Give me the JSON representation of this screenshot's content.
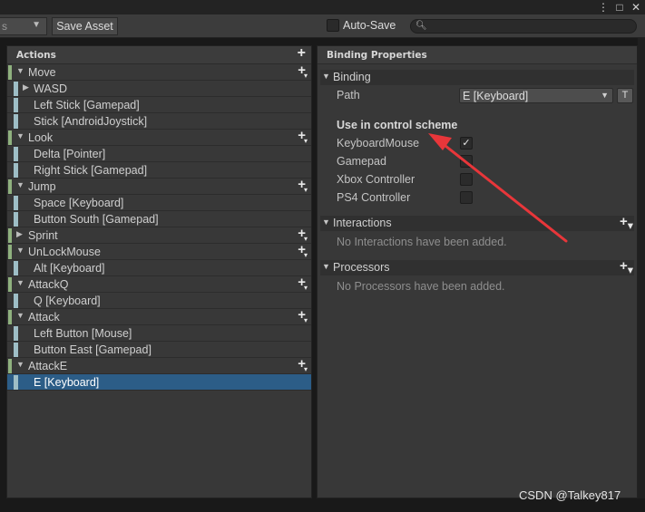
{
  "window": {
    "more_icon": "kebab-menu-icon",
    "maximize_icon": "maximize-icon",
    "close_icon": "close-icon"
  },
  "toolbar": {
    "control_scheme_partial": "s",
    "save_asset_label": "Save Asset",
    "auto_save_label": "Auto-Save",
    "auto_save_checked": false,
    "search_value": ""
  },
  "actions_pane": {
    "header": "Actions",
    "rows": [
      {
        "kind": "action",
        "label": "Move"
      },
      {
        "kind": "composite",
        "label": "WASD"
      },
      {
        "kind": "binding",
        "label": "Left Stick [Gamepad]"
      },
      {
        "kind": "binding",
        "label": "Stick [AndroidJoystick]"
      },
      {
        "kind": "action",
        "label": "Look"
      },
      {
        "kind": "binding",
        "label": "Delta [Pointer]"
      },
      {
        "kind": "binding",
        "label": "Right Stick [Gamepad]"
      },
      {
        "kind": "action",
        "label": "Jump"
      },
      {
        "kind": "binding",
        "label": "Space [Keyboard]"
      },
      {
        "kind": "binding",
        "label": "Button South [Gamepad]"
      },
      {
        "kind": "action-collapsed",
        "label": "Sprint"
      },
      {
        "kind": "action",
        "label": "UnLockMouse"
      },
      {
        "kind": "binding",
        "label": "Alt [Keyboard]"
      },
      {
        "kind": "action",
        "label": "AttackQ"
      },
      {
        "kind": "binding",
        "label": "Q [Keyboard]"
      },
      {
        "kind": "action",
        "label": "Attack"
      },
      {
        "kind": "binding",
        "label": "Left Button [Mouse]"
      },
      {
        "kind": "binding",
        "label": "Button East [Gamepad]"
      },
      {
        "kind": "action",
        "label": "AttackE"
      },
      {
        "kind": "binding",
        "label": "E [Keyboard]",
        "selected": true
      }
    ]
  },
  "props_pane": {
    "header": "Binding Properties",
    "binding_section": "Binding",
    "path_label": "Path",
    "path_value": "E [Keyboard]",
    "t_button": "T",
    "use_in_scheme_heading": "Use in control scheme",
    "schemes": [
      {
        "label": "KeyboardMouse",
        "checked": true
      },
      {
        "label": "Gamepad",
        "checked": false
      },
      {
        "label": "Xbox Controller",
        "checked": false
      },
      {
        "label": "PS4 Controller",
        "checked": false
      }
    ],
    "interactions_section": "Interactions",
    "interactions_empty": "No Interactions have been added.",
    "processors_section": "Processors",
    "processors_empty": "No Processors have been added."
  },
  "annotation": {
    "color": "#e8363a"
  },
  "watermark": "CSDN @Talkey817"
}
